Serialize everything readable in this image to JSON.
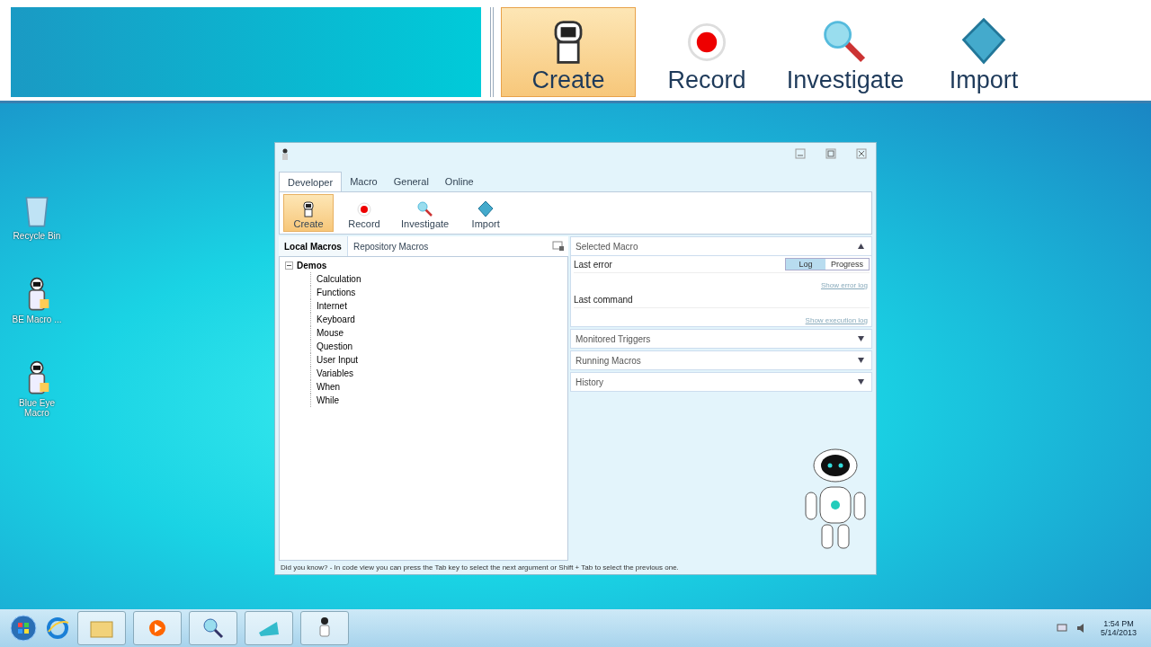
{
  "zoomed_ribbon": {
    "buttons": [
      {
        "label": "Create",
        "kind": "create",
        "selected": true
      },
      {
        "label": "Record",
        "kind": "record",
        "selected": false
      },
      {
        "label": "Investigate",
        "kind": "investigate",
        "selected": false
      },
      {
        "label": "Import",
        "kind": "import",
        "selected": false
      }
    ]
  },
  "desktop_icons": [
    {
      "label": "Recycle Bin",
      "kind": "bin"
    },
    {
      "label": "BE Macro ...",
      "kind": "robot"
    },
    {
      "label": "Blue Eye Macro",
      "kind": "robot"
    }
  ],
  "window": {
    "tabs": [
      {
        "label": "Developer",
        "selected": true
      },
      {
        "label": "Macro",
        "selected": false
      },
      {
        "label": "General",
        "selected": false
      },
      {
        "label": "Online",
        "selected": false
      }
    ],
    "ribbon_buttons": [
      {
        "label": "Create",
        "kind": "create",
        "selected": true
      },
      {
        "label": "Record",
        "kind": "record",
        "selected": false
      },
      {
        "label": "Investigate",
        "kind": "investigate",
        "selected": false
      },
      {
        "label": "Import",
        "kind": "import",
        "selected": false
      }
    ],
    "panel_tabs": [
      {
        "label": "Local Macros",
        "selected": true
      },
      {
        "label": "Repository Macros",
        "selected": false
      }
    ],
    "tree": {
      "label": "Demos",
      "expanded": true,
      "children": [
        {
          "label": "Calculation"
        },
        {
          "label": "Functions"
        },
        {
          "label": "Internet"
        },
        {
          "label": "Keyboard"
        },
        {
          "label": "Mouse"
        },
        {
          "label": "Question"
        },
        {
          "label": "User Input"
        },
        {
          "label": "Variables"
        },
        {
          "label": "When"
        },
        {
          "label": "While"
        }
      ]
    },
    "selected_macro": {
      "title": "Selected Macro",
      "expanded": true,
      "last_error_label": "Last error",
      "last_command_label": "Last command",
      "view_toggle": [
        {
          "label": "Log",
          "selected": true
        },
        {
          "label": "Progress",
          "selected": false
        }
      ],
      "error_log_link": "Show error log",
      "execution_log_link": "Show execution log"
    },
    "sections": [
      {
        "title": "Monitored Triggers",
        "expanded": false
      },
      {
        "title": "Running Macros",
        "expanded": false
      },
      {
        "title": "History",
        "expanded": false
      }
    ],
    "tip": "Did you know? - In code view you can press the Tab key to select the next argument or Shift + Tab to select the previous one."
  },
  "taskbar": {
    "time": "1:54 PM",
    "date": "5/14/2013"
  }
}
